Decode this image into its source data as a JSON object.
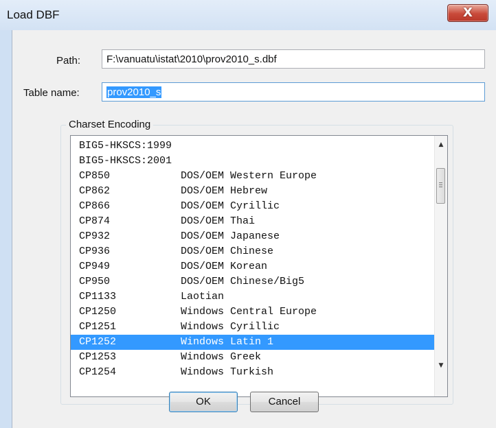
{
  "window": {
    "title": "Load DBF",
    "close_symbol": "X"
  },
  "path": {
    "label": "Path:",
    "value": "F:\\vanuatu\\istat\\2010\\prov2010_s.dbf"
  },
  "table_name": {
    "label": "Table name:",
    "value": "prov2010_s"
  },
  "charset": {
    "group_label": "Charset Encoding",
    "items": [
      {
        "code": "BIG5-HKSCS:1999",
        "desc": ""
      },
      {
        "code": "BIG5-HKSCS:2001",
        "desc": ""
      },
      {
        "code": "CP850",
        "desc": "DOS/OEM Western Europe"
      },
      {
        "code": "CP862",
        "desc": "DOS/OEM Hebrew"
      },
      {
        "code": "CP866",
        "desc": "DOS/OEM Cyrillic"
      },
      {
        "code": "CP874",
        "desc": "DOS/OEM Thai"
      },
      {
        "code": "CP932",
        "desc": "DOS/OEM Japanese"
      },
      {
        "code": "CP936",
        "desc": "DOS/OEM Chinese"
      },
      {
        "code": "CP949",
        "desc": "DOS/OEM Korean"
      },
      {
        "code": "CP950",
        "desc": "DOS/OEM Chinese/Big5"
      },
      {
        "code": "CP1133",
        "desc": "Laotian"
      },
      {
        "code": "CP1250",
        "desc": "Windows Central Europe"
      },
      {
        "code": "CP1251",
        "desc": "Windows Cyrillic"
      },
      {
        "code": "CP1252",
        "desc": "Windows Latin 1"
      },
      {
        "code": "CP1253",
        "desc": "Windows Greek"
      },
      {
        "code": "CP1254",
        "desc": "Windows Turkish"
      }
    ],
    "selected_code": "CP1252",
    "scroll_up": "▲",
    "scroll_down": "▼"
  },
  "buttons": {
    "ok": "OK",
    "cancel": "Cancel"
  },
  "colors": {
    "selection": "#3399ff",
    "close_button": "#c94a3a"
  }
}
